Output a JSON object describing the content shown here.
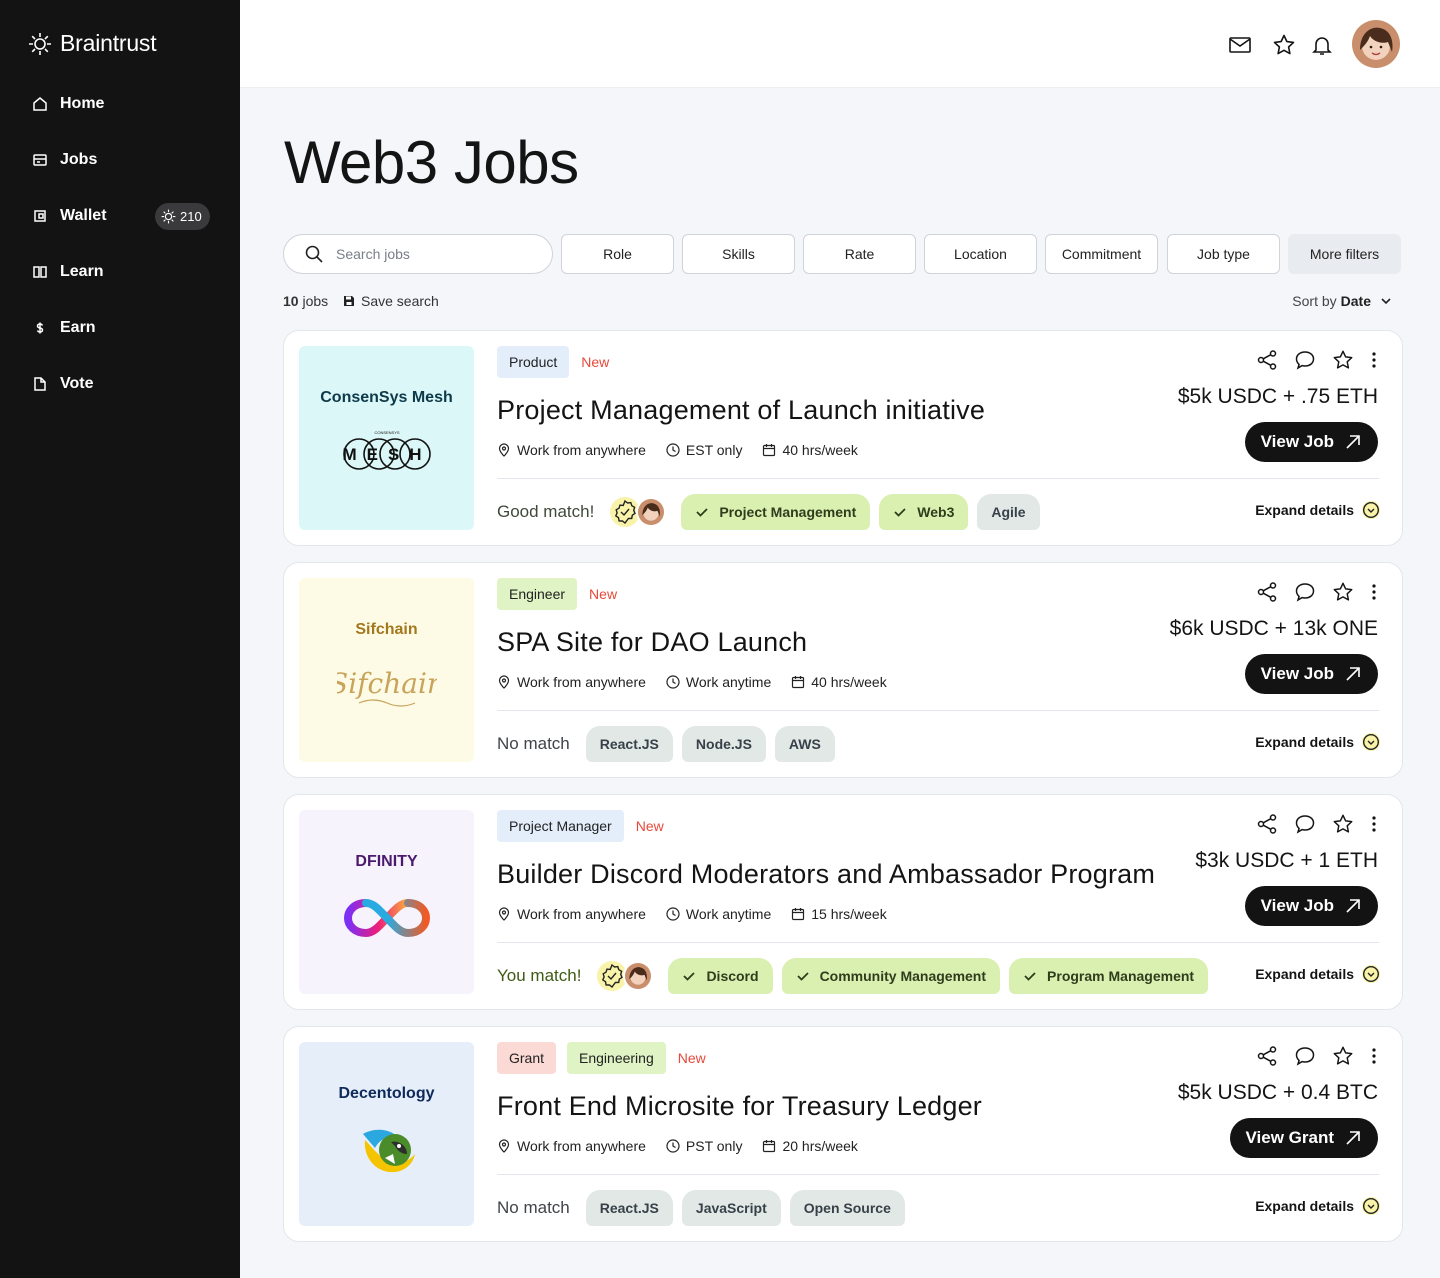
{
  "app": {
    "brand": "Braintrust"
  },
  "sidebar": {
    "items": [
      {
        "label": "Home",
        "icon": "home-icon"
      },
      {
        "label": "Jobs",
        "icon": "jobs-icon"
      },
      {
        "label": "Wallet",
        "icon": "wallet-icon",
        "badge": "210"
      },
      {
        "label": "Learn",
        "icon": "book-icon"
      },
      {
        "label": "Earn",
        "icon": "dollar-icon"
      },
      {
        "label": "Vote",
        "icon": "document-icon"
      }
    ]
  },
  "topbar": {
    "icons": [
      "mail-icon",
      "star-icon",
      "bell-icon"
    ],
    "avatar": "user-avatar"
  },
  "page": {
    "title": "Web3 Jobs"
  },
  "search": {
    "placeholder": "Search jobs"
  },
  "filters": [
    "Role",
    "Skills",
    "Rate",
    "Location",
    "Commitment",
    "Job type",
    "More filters"
  ],
  "results": {
    "count": "10",
    "count_suffix": "jobs",
    "save_label": "Save search",
    "sort_prefix": "Sort by",
    "sort_value": "Date"
  },
  "jobs": [
    {
      "company": "ConsenSys Mesh",
      "logo_bg": "#dcf7f7",
      "tags": [
        {
          "label": "Product",
          "kind": "product"
        }
      ],
      "new_label": "New",
      "title": "Project Management of Launch initiative",
      "location": "Work from anywhere",
      "time": "EST only",
      "hours": "40 hrs/week",
      "match_label": "Good match!",
      "match_kind": "good",
      "skills": [
        {
          "label": "Project Management",
          "matched": true
        },
        {
          "label": "Web3",
          "matched": true
        },
        {
          "label": "Agile",
          "matched": false
        }
      ],
      "price": "$5k USDC + .75 ETH",
      "button": "View Job",
      "expand": "Expand details"
    },
    {
      "company": "Sifchain",
      "logo_bg": "#fdfbe6",
      "tags": [
        {
          "label": "Engineer",
          "kind": "engineer"
        }
      ],
      "new_label": "New",
      "title": "SPA Site for DAO Launch",
      "location": "Work from anywhere",
      "time": "Work anytime",
      "hours": "40 hrs/week",
      "match_label": "No match",
      "match_kind": "no",
      "skills": [
        {
          "label": "React.JS",
          "matched": false
        },
        {
          "label": "Node.JS",
          "matched": false
        },
        {
          "label": "AWS",
          "matched": false
        }
      ],
      "price": "$6k USDC + 13k ONE",
      "button": "View Job",
      "expand": "Expand details"
    },
    {
      "company": "DFINITY",
      "logo_bg": "#f6f3fd",
      "tags": [
        {
          "label": "Project Manager",
          "kind": "pm"
        }
      ],
      "new_label": "New",
      "title": "Builder Discord Moderators and Ambassador Program",
      "location": "Work from anywhere",
      "time": "Work anytime",
      "hours": "15 hrs/week",
      "match_label": "You match!",
      "match_kind": "you",
      "skills": [
        {
          "label": "Discord",
          "matched": true
        },
        {
          "label": "Community Management",
          "matched": true
        },
        {
          "label": "Program Management",
          "matched": true
        }
      ],
      "price": "$3k USDC + 1 ETH",
      "button": "View Job",
      "expand": "Expand details"
    },
    {
      "company": "Decentology",
      "logo_bg": "#e6eff9",
      "tags": [
        {
          "label": "Grant",
          "kind": "grant"
        },
        {
          "label": "Engineering",
          "kind": "engineering"
        }
      ],
      "new_label": "New",
      "title": "Front End Microsite for Treasury Ledger",
      "location": "Work from anywhere",
      "time": "PST only",
      "hours": "20 hrs/week",
      "match_label": "No match",
      "match_kind": "no",
      "skills": [
        {
          "label": "React.JS",
          "matched": false
        },
        {
          "label": "JavaScript",
          "matched": false
        },
        {
          "label": "Open Source",
          "matched": false
        }
      ],
      "price": "$5k USDC + 0.4 BTC",
      "button": "View Grant",
      "expand": "Expand details"
    }
  ]
}
